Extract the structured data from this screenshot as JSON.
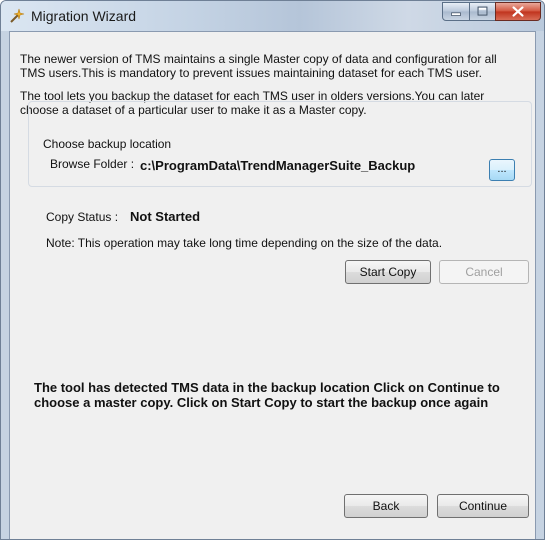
{
  "window": {
    "title": "Migration Wizard"
  },
  "intro": {
    "paragraph1": "The newer version of TMS maintains a single Master copy of data and configuration for all TMS users.This is mandatory to prevent issues maintaining dataset for each TMS user.",
    "paragraph2": "The tool lets you backup the dataset for each TMS user in olders versions.You can later choose a dataset of a particular user to make it as a Master copy."
  },
  "backup": {
    "group_label": "Choose backup location",
    "folder_label": "Browse Folder :",
    "folder_path": "c:\\ProgramData\\TrendManagerSuite_Backup",
    "browse_button": "..."
  },
  "copy": {
    "status_label": "Copy Status :",
    "status_value": "Not Started",
    "note": "Note: This operation may take long time depending on the size of the data.",
    "start_button": "Start Copy",
    "cancel_button": "Cancel"
  },
  "message": "The tool has detected TMS data in the backup location Click on Continue to choose a master copy. Click on Start Copy to start the backup once again",
  "footer": {
    "back_button": "Back",
    "continue_button": "Continue"
  },
  "colors": {
    "close_button": "#c0321d",
    "dialog_background": "#f0f0f0",
    "frame": "#b8c8dc"
  },
  "icons": {
    "app": "wizard-icon",
    "minimize": "minimize-icon",
    "maximize": "maximize-icon",
    "close": "close-icon"
  }
}
